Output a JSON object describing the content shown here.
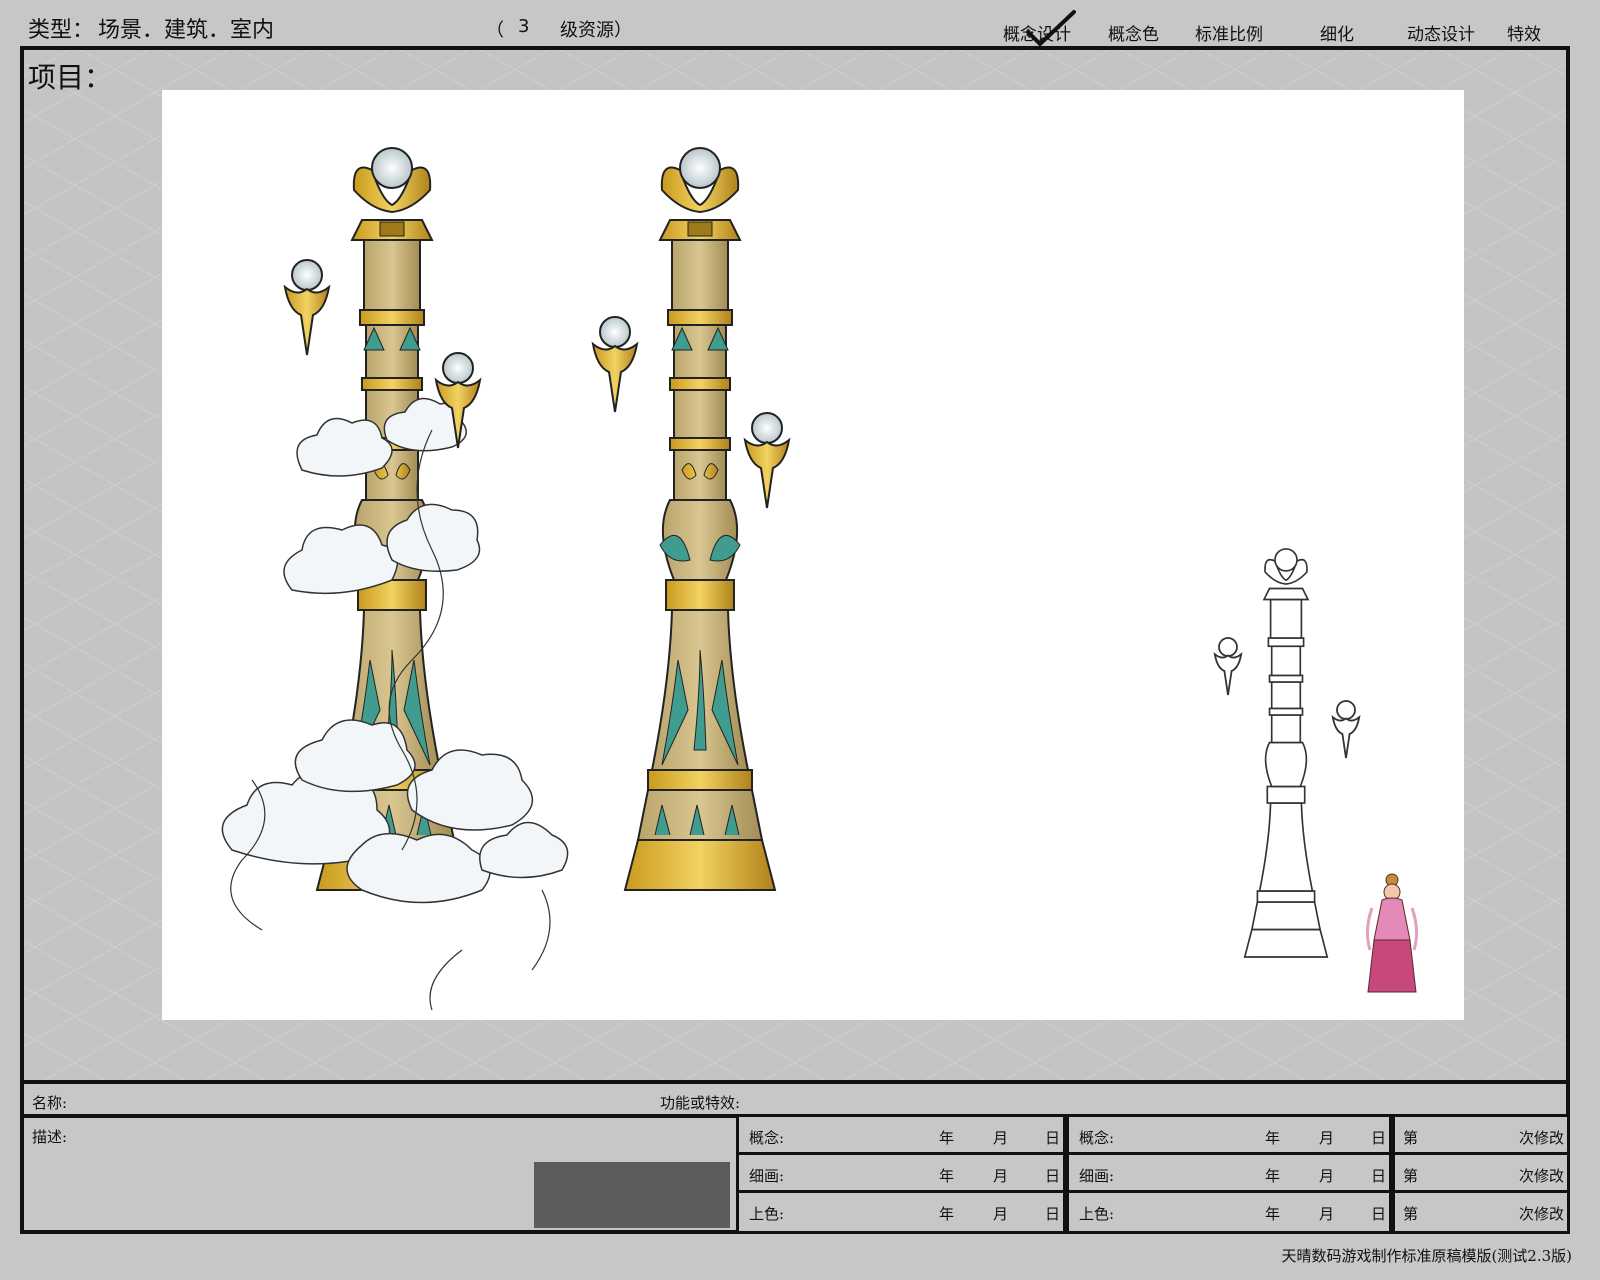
{
  "header": {
    "type_label": "类型：",
    "type_value": "场景．建筑．室内",
    "level_open": "（",
    "level_num": "3",
    "level_text": "级资源）",
    "stages": [
      "概念设计",
      "概念色",
      "标准比例",
      "细化",
      "动态设计",
      "特效"
    ],
    "checked_stage": "概念设计"
  },
  "project_label": "项目：",
  "info": {
    "name_label": "名称:",
    "function_label": "功能或特效:",
    "desc_label": "描述:"
  },
  "dates": {
    "row_labels": [
      "概念:",
      "细画:",
      "上色:"
    ],
    "year": "年",
    "month": "月",
    "day": "日",
    "rev_prefix": "第",
    "rev_suffix": "次修改"
  },
  "footer": "天晴数码游戏制作标准原稿模版(测试2.3版)"
}
